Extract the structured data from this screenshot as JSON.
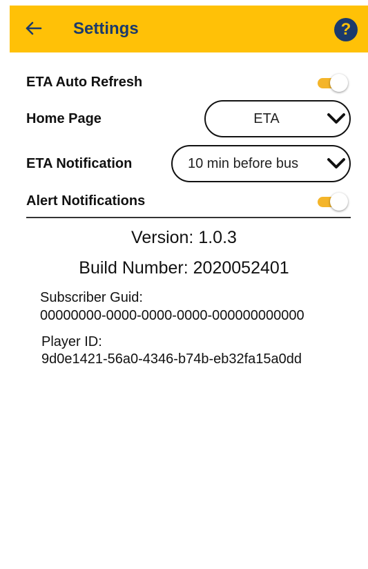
{
  "header": {
    "title": "Settings",
    "background_color": "#FFC107",
    "title_color": "#1B3A6B",
    "back_icon": "arrow-left-icon",
    "help_icon": "question-mark-icon",
    "help_glyph": "?"
  },
  "settings": {
    "eta_auto_refresh": {
      "label": "ETA Auto Refresh",
      "enabled": true
    },
    "home_page": {
      "label": "Home Page",
      "selected": "ETA"
    },
    "eta_notification": {
      "label": "ETA Notification",
      "selected": "10 min before bus"
    },
    "alert_notifications": {
      "label": "Alert Notifications",
      "enabled": true
    }
  },
  "about": {
    "version": "Version: 1.0.3",
    "build_number": "Build Number: 2020052401",
    "subscriber_guid_label": "Subscriber Guid:",
    "subscriber_guid_value": "00000000-0000-0000-0000-000000000000",
    "player_id_label": "Player ID:",
    "player_id_value": "9d0e1421-56a0-4346-b74b-eb32fa15a0dd"
  },
  "colors": {
    "toggle_on": "#F4B52A",
    "accent": "#FFC107"
  }
}
